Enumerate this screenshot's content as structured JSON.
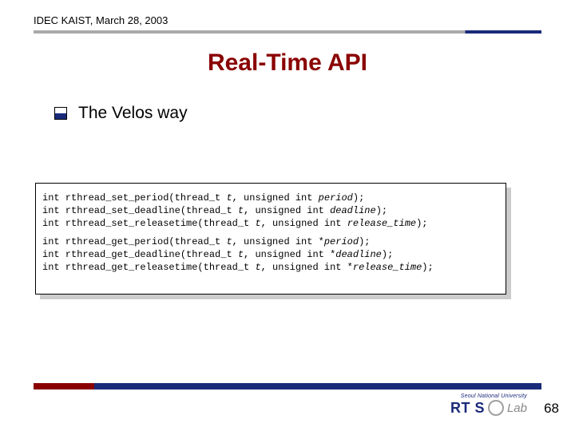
{
  "header": "IDEC KAIST, March 28, 2003",
  "title": "Real-Time API",
  "bullet": "The Velos way",
  "code": {
    "l1_a": "int rthread_set_period(thread_t ",
    "l1_t": "t",
    "l1_b": ", unsigned int ",
    "l1_p": "period",
    "l1_c": ");",
    "l2_a": "int rthread_set_deadline(thread_t ",
    "l2_t": "t",
    "l2_b": ", unsigned int ",
    "l2_p": "deadline",
    "l2_c": ");",
    "l3_a": "int rthread_set_releasetime(thread_t ",
    "l3_t": "t",
    "l3_b": ", unsigned int ",
    "l3_p": "release_time",
    "l3_c": ");",
    "l4_a": "int rthread_get_period(thread_t ",
    "l4_t": "t",
    "l4_b": ", unsigned int *",
    "l4_p": "period",
    "l4_c": ");",
    "l5_a": "int rthread_get_deadline(thread_t ",
    "l5_t": "t",
    "l5_b": ", unsigned int *",
    "l5_p": "deadline",
    "l5_c": ");",
    "l6_a": "int rthread_get_releasetime(thread_t ",
    "l6_t": "t",
    "l6_b": ", unsigned int *",
    "l6_p": "release_time",
    "l6_c": ");"
  },
  "footer": {
    "univ": "Seoul National University",
    "rtos": "RT S",
    "lab": "Lab",
    "page": "68"
  }
}
